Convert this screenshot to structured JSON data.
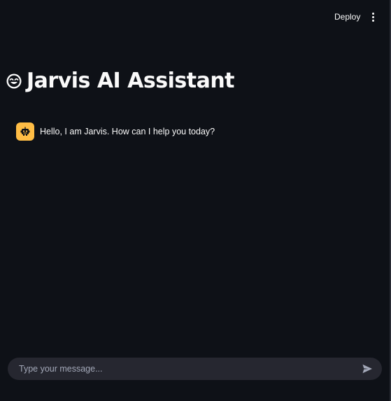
{
  "header": {
    "deploy_label": "Deploy",
    "menu_icon": "kebab-menu-icon"
  },
  "page": {
    "title": "Jarvis AI Assistant",
    "title_icon": "smiling-face-icon"
  },
  "messages": [
    {
      "role": "assistant",
      "avatar_icon": "robot-icon",
      "text": "Hello, I am Jarvis. How can I help you today?"
    }
  ],
  "chat_input": {
    "placeholder": "Type your message...",
    "value": "",
    "send_icon": "send-icon"
  },
  "colors": {
    "background": "#0e1117",
    "text": "#fafafa",
    "avatar_bg": "#ffbd45",
    "input_bg": "#262730",
    "placeholder": "#a3a8b8"
  }
}
